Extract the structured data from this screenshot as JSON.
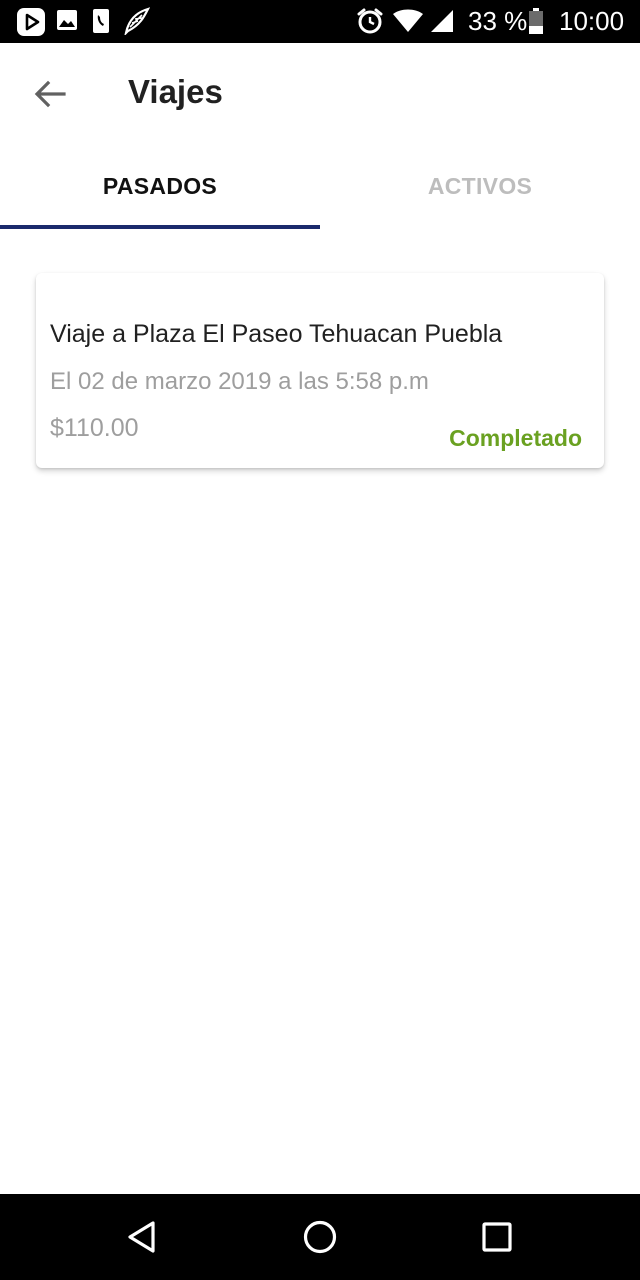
{
  "status_bar": {
    "icons_left": [
      "play-store-icon",
      "image-icon",
      "phone-icon",
      "feather-icon"
    ],
    "icons_right": [
      "alarm-icon",
      "wifi-icon",
      "signal-icon",
      "battery-icon"
    ],
    "battery_text": "33 %",
    "time": "10:00"
  },
  "app_bar": {
    "back_icon": "arrow-left-icon",
    "title": "Viajes"
  },
  "tabs": [
    {
      "label": "PASADOS",
      "active": true
    },
    {
      "label": "ACTIVOS",
      "active": false
    }
  ],
  "trips": [
    {
      "title": "Viaje a Plaza El Paseo Tehuacan Puebla",
      "date": "El 02 de marzo 2019 a las 5:58 p.m",
      "price": "$110.00",
      "status": "Completado"
    }
  ],
  "colors": {
    "tab_indicator": "#1a2a6c",
    "status_completed": "#6aa121",
    "secondary_text": "#9e9e9e"
  },
  "nav_bar": {
    "buttons": [
      "back-triangle-icon",
      "home-circle-icon",
      "recents-square-icon"
    ]
  }
}
